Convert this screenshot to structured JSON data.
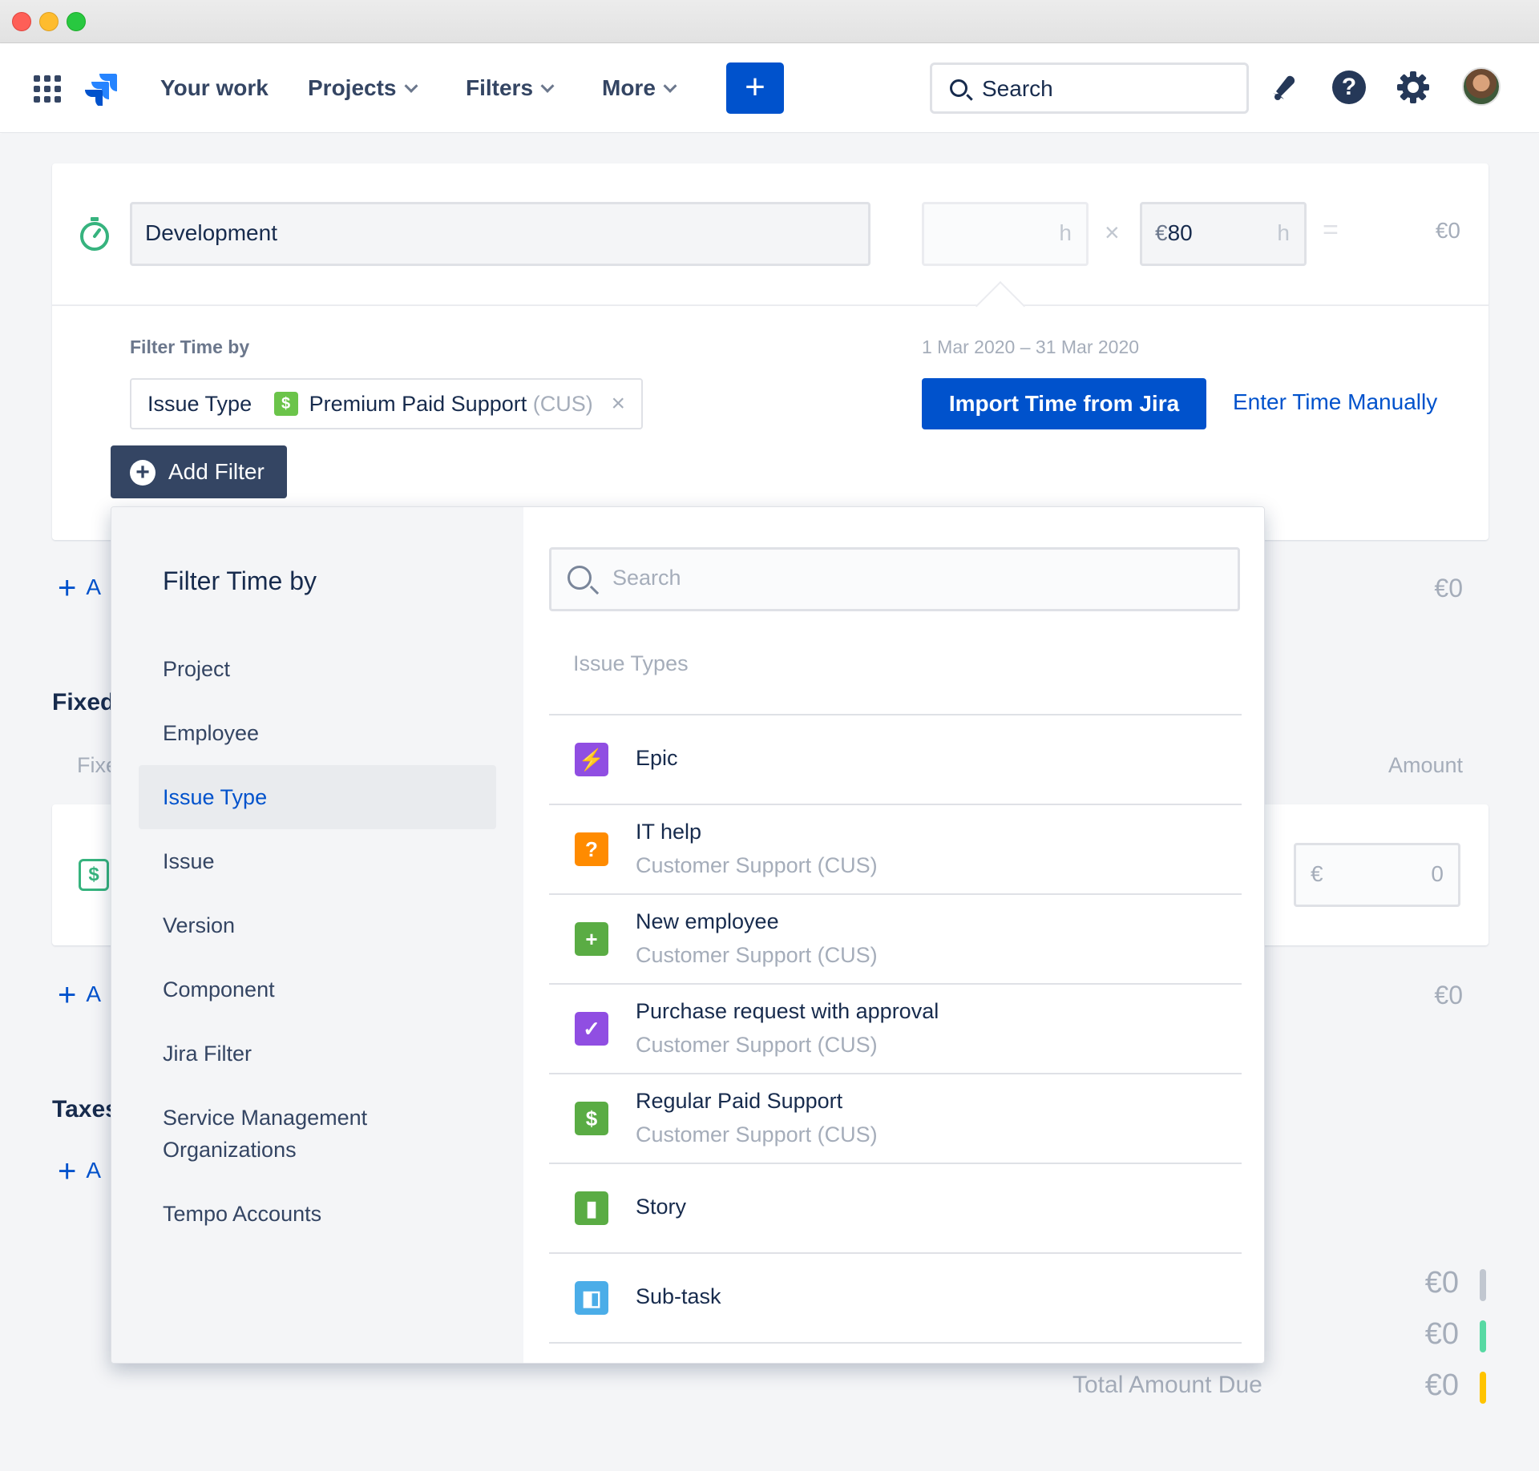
{
  "nav": {
    "your_work": "Your work",
    "projects": "Projects",
    "filters": "Filters",
    "more": "More",
    "create_label": "+",
    "search_label": "Search",
    "icons": [
      "app-switcher-icon",
      "jira-logo",
      "notifications-icon",
      "help-icon",
      "settings-icon",
      "avatar"
    ]
  },
  "entry": {
    "description": "Development",
    "hours_unit": "h",
    "times_symbol": "×",
    "rate_currency": "€",
    "rate_value": "80",
    "rate_unit": "h",
    "equals_symbol": "=",
    "total": "€0"
  },
  "filter": {
    "label": "Filter Time by",
    "date_range": "1 Mar 2020 – 31 Mar 2020",
    "chip_field": "Issue Type",
    "chip_icon": "$",
    "chip_value": "Premium Paid Support",
    "chip_project": "(CUS)",
    "chip_remove": "×",
    "import_button": "Import Time from Jira",
    "manual_link": "Enter Time Manually",
    "add_filter_button": "Add Filter"
  },
  "background": {
    "add_label": "A",
    "row_total_1": "€0",
    "fixed_title": "Fixed",
    "fixed_sub": "Fixe",
    "amount_header": "Amount",
    "amount_currency": "€",
    "amount_value": "0",
    "row_total_2": "€0",
    "taxes_title": "Taxes",
    "summary_1": "€0",
    "summary_2": "€0",
    "summary_3": "€0",
    "total_amount_label": "Total Amount Due",
    "colors": {
      "bar1": "#c1c7d0",
      "bar2": "#57d9a3",
      "bar3": "#ffc400"
    }
  },
  "dropdown": {
    "title": "Filter Time by",
    "categories": [
      "Project",
      "Employee",
      "Issue Type",
      "Issue",
      "Version",
      "Component",
      "Jira Filter",
      "Service Management Organizations",
      "Tempo Accounts"
    ],
    "active_category": "Issue Type",
    "search_placeholder": "Search",
    "group_label": "Issue Types",
    "issue_types": [
      {
        "name": "Epic",
        "project": "",
        "icon": "epic-icon",
        "color": "#904ee2",
        "glyph": "⚡"
      },
      {
        "name": "IT help",
        "project": "Customer Support (CUS)",
        "icon": "it-help-icon",
        "color": "#ff8b00",
        "glyph": "?"
      },
      {
        "name": "New employee",
        "project": "Customer Support (CUS)",
        "icon": "new-employee-icon",
        "color": "#5aac44",
        "glyph": "+"
      },
      {
        "name": "Purchase request with approval",
        "project": "Customer Support (CUS)",
        "icon": "purchase-request-icon",
        "color": "#904ee2",
        "glyph": "✓"
      },
      {
        "name": "Regular Paid Support",
        "project": "Customer Support (CUS)",
        "icon": "dollar-icon",
        "color": "#5aac44",
        "glyph": "$"
      },
      {
        "name": "Story",
        "project": "",
        "icon": "story-icon",
        "color": "#5aac44",
        "glyph": "▮"
      },
      {
        "name": "Sub-task",
        "project": "",
        "icon": "subtask-icon",
        "color": "#4bade8",
        "glyph": "◧"
      }
    ]
  }
}
